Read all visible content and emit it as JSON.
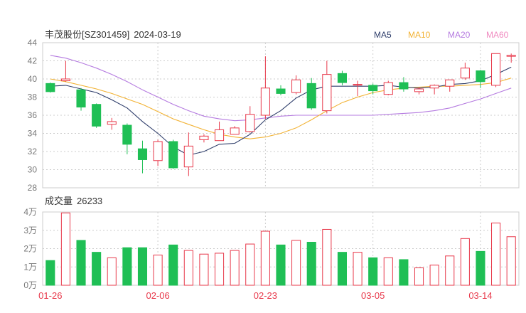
{
  "header": {
    "stock_label": "丰茂股份[SZ301459]",
    "date": "2024-03-19",
    "ma_legend": [
      {
        "label": "MA5",
        "color": "#2f3e6b"
      },
      {
        "label": "MA10",
        "color": "#f2b233"
      },
      {
        "label": "MA20",
        "color": "#b57be0"
      },
      {
        "label": "MA60",
        "color": "#f08ac0"
      }
    ]
  },
  "volume_header": {
    "label": "成交量",
    "value": "26233"
  },
  "colors": {
    "up": "#e8384a",
    "down": "#1fbf55",
    "grid": "#cccccc",
    "axis": "#777777"
  },
  "chart_data": [
    {
      "type": "candlestick",
      "ylim": [
        28,
        44
      ],
      "y_ticks": [
        "44",
        "42",
        "40",
        "38",
        "36",
        "34",
        "32",
        "30",
        "28"
      ],
      "x_ticks": [
        {
          "label": "01-26",
          "index": 0
        },
        {
          "label": "02-06",
          "index": 7
        },
        {
          "label": "02-23",
          "index": 14
        },
        {
          "label": "03-05",
          "index": 21
        },
        {
          "label": "03-14",
          "index": 28
        }
      ],
      "candles": [
        {
          "o": 39.5,
          "h": 39.6,
          "l": 38.5,
          "c": 38.6
        },
        {
          "o": 39.8,
          "h": 42.0,
          "l": 39.7,
          "c": 40.0
        },
        {
          "o": 38.8,
          "h": 39.0,
          "l": 36.5,
          "c": 36.9
        },
        {
          "o": 37.2,
          "h": 37.3,
          "l": 34.6,
          "c": 34.8
        },
        {
          "o": 35.0,
          "h": 35.7,
          "l": 34.4,
          "c": 35.3
        },
        {
          "o": 34.9,
          "h": 35.1,
          "l": 31.7,
          "c": 32.8
        },
        {
          "o": 32.3,
          "h": 33.2,
          "l": 29.6,
          "c": 31.1
        },
        {
          "o": 31.0,
          "h": 33.3,
          "l": 30.4,
          "c": 33.1
        },
        {
          "o": 33.1,
          "h": 33.3,
          "l": 30.1,
          "c": 30.2
        },
        {
          "o": 30.3,
          "h": 34.1,
          "l": 29.3,
          "c": 32.6
        },
        {
          "o": 33.3,
          "h": 33.9,
          "l": 33.0,
          "c": 33.7
        },
        {
          "o": 33.2,
          "h": 35.3,
          "l": 33.2,
          "c": 34.4
        },
        {
          "o": 33.9,
          "h": 34.8,
          "l": 33.9,
          "c": 34.6
        },
        {
          "o": 34.2,
          "h": 37.0,
          "l": 34.1,
          "c": 36.1
        },
        {
          "o": 36.0,
          "h": 42.5,
          "l": 35.6,
          "c": 39.0
        },
        {
          "o": 38.9,
          "h": 39.3,
          "l": 38.2,
          "c": 38.4
        },
        {
          "o": 38.5,
          "h": 40.4,
          "l": 38.3,
          "c": 39.9
        },
        {
          "o": 39.5,
          "h": 40.1,
          "l": 36.6,
          "c": 36.8
        },
        {
          "o": 36.5,
          "h": 42.0,
          "l": 36.2,
          "c": 40.5
        },
        {
          "o": 40.6,
          "h": 40.9,
          "l": 39.3,
          "c": 39.6
        },
        {
          "o": 39.4,
          "h": 39.8,
          "l": 38.1,
          "c": 39.4
        },
        {
          "o": 39.3,
          "h": 39.5,
          "l": 38.3,
          "c": 38.7
        },
        {
          "o": 38.3,
          "h": 39.8,
          "l": 38.2,
          "c": 39.6
        },
        {
          "o": 39.6,
          "h": 40.2,
          "l": 38.6,
          "c": 38.9
        },
        {
          "o": 38.6,
          "h": 39.1,
          "l": 38.3,
          "c": 38.9
        },
        {
          "o": 39.0,
          "h": 39.4,
          "l": 38.3,
          "c": 39.3
        },
        {
          "o": 39.2,
          "h": 39.9,
          "l": 38.6,
          "c": 39.9
        },
        {
          "o": 40.1,
          "h": 41.8,
          "l": 39.9,
          "c": 41.2
        },
        {
          "o": 40.9,
          "h": 41.0,
          "l": 39.0,
          "c": 39.7
        },
        {
          "o": 39.3,
          "h": 42.8,
          "l": 39.1,
          "c": 42.8
        },
        {
          "o": 42.5,
          "h": 42.8,
          "l": 41.8,
          "c": 42.6
        }
      ],
      "ma5": [
        39.2,
        39.3,
        38.9,
        38.5,
        37.7,
        36.8,
        35.3,
        34.0,
        32.5,
        31.6,
        32.0,
        32.8,
        32.9,
        33.9,
        35.5,
        36.5,
        37.9,
        38.8,
        39.2,
        39.2,
        39.2,
        39.2,
        39.3,
        39.1,
        39.0,
        39.1,
        39.4,
        39.5,
        39.8,
        40.5,
        41.3
      ],
      "ma10": [
        40.0,
        39.7,
        39.3,
        38.9,
        38.4,
        37.8,
        37.2,
        36.4,
        35.6,
        35.0,
        34.4,
        33.9,
        33.6,
        33.4,
        33.6,
        34.0,
        34.6,
        35.5,
        36.5,
        37.4,
        38.0,
        38.5,
        38.8,
        39.0,
        39.1,
        39.2,
        39.2,
        39.3,
        39.4,
        39.6,
        40.1
      ],
      "ma20": [
        42.6,
        42.3,
        41.8,
        41.2,
        40.5,
        39.7,
        38.8,
        38.0,
        37.2,
        36.5,
        35.9,
        35.6,
        35.4,
        35.5,
        35.7,
        35.9,
        36.0,
        36.0,
        36.0,
        36.0,
        36.0,
        36.0,
        36.1,
        36.2,
        36.3,
        36.5,
        36.8,
        37.3,
        37.8,
        38.4,
        39.0
      ],
      "ma60": null
    },
    {
      "type": "bar",
      "name": "成交量",
      "unit": "万",
      "ylim": [
        0,
        40000
      ],
      "y_ticks": [
        "4万",
        "3万",
        "2万",
        "1万",
        "0万"
      ],
      "values": [
        13500,
        39500,
        24500,
        18000,
        15000,
        20500,
        20500,
        16500,
        22000,
        19000,
        17000,
        17500,
        19000,
        22500,
        29500,
        22000,
        24500,
        23500,
        30500,
        18000,
        18000,
        15000,
        15000,
        14000,
        9500,
        11000,
        16000,
        25500,
        18500,
        34000,
        26500
      ]
    }
  ]
}
